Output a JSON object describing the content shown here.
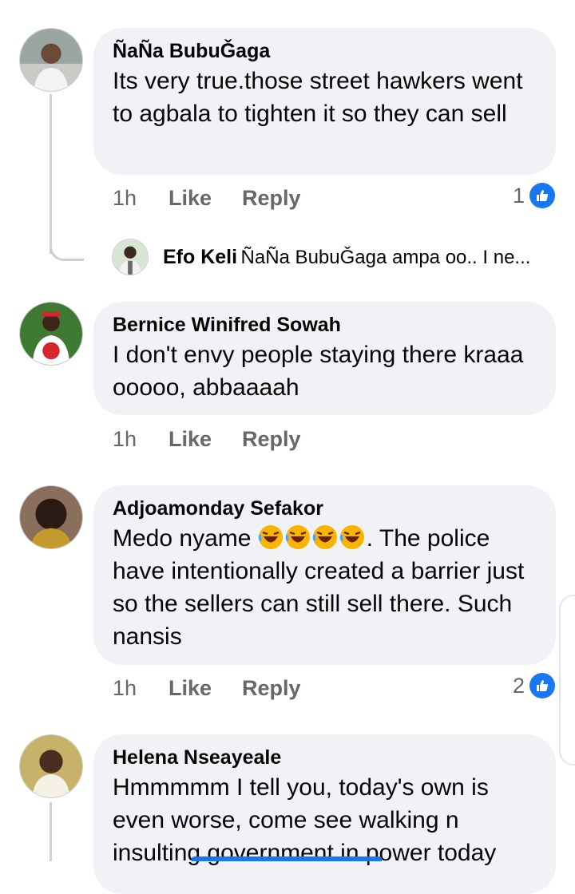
{
  "comments": [
    {
      "name": "ÑaÑa BubuǦaga",
      "text": "Its very true.those street hawkers went to agbala to tighten it so they can sell",
      "time": "1h",
      "like_label": "Like",
      "reply_label": "Reply",
      "reaction_count": "1",
      "reply": {
        "name": "Efo Keli",
        "text": "ÑaÑa BubuǦaga ampa oo.. I ne..."
      }
    },
    {
      "name": "Bernice Winifred Sowah",
      "text": "I don't envy people staying there kraaa ooooo, abbaaaah",
      "time": "1h",
      "like_label": "Like",
      "reply_label": "Reply"
    },
    {
      "name": "Adjoamonday Sefakor",
      "text_before": "Medo nyame ",
      "emoji": "rofl-emoji",
      "text_after": ". The police have intentionally created a barrier just so the sellers can still sell there. Such nansis",
      "time": "1h",
      "like_label": "Like",
      "reply_label": "Reply",
      "reaction_count": "2"
    },
    {
      "name": "Helena Nseayeale",
      "text": "Hmmmmm I tell you, today's own is even worse, come see walking n insulting government in power today"
    }
  ],
  "colors": {
    "bubble": "#f0f2f5",
    "meta": "#65676b",
    "accent": "#1877f2"
  }
}
